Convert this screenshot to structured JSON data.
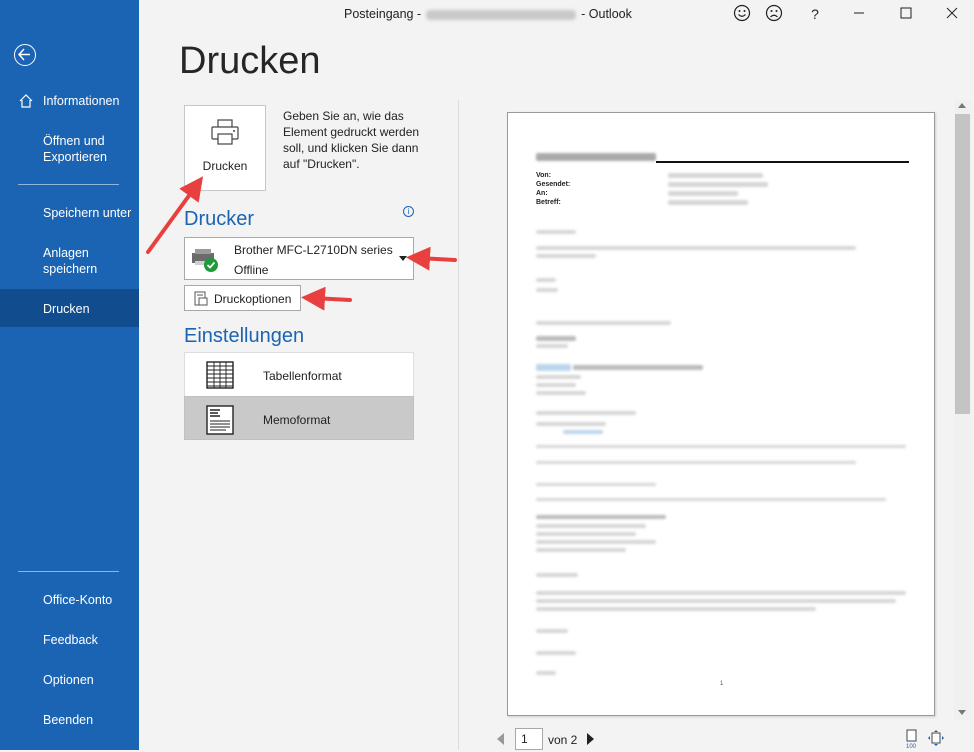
{
  "window": {
    "title_prefix": "Posteingang -",
    "title_suffix": "- Outlook",
    "happy_icon": "smile-icon",
    "sad_icon": "frown-icon",
    "help_label": "?"
  },
  "sidebar": {
    "items": [
      {
        "label": "Informationen"
      },
      {
        "label": "Öffnen und Exportieren"
      },
      {
        "label": "Speichern unter"
      },
      {
        "label": "Anlagen speichern"
      },
      {
        "label": "Drucken"
      },
      {
        "label": "Office-Konto"
      },
      {
        "label": "Feedback"
      },
      {
        "label": "Optionen"
      },
      {
        "label": "Beenden"
      }
    ]
  },
  "main": {
    "title": "Drucken",
    "print_button_label": "Drucken",
    "help_text": "Geben Sie an, wie das Element gedruckt werden soll, und klicken Sie dann auf \"Drucken\".",
    "printer_heading": "Drucker",
    "printer_name": "Brother MFC-L2710DN series",
    "printer_status": "Offline",
    "print_options_label": "Druckoptionen",
    "settings_heading": "Einstellungen",
    "formats": [
      {
        "label": "Tabellenformat",
        "selected": false
      },
      {
        "label": "Memoformat",
        "selected": true
      }
    ]
  },
  "preview": {
    "header_labels": [
      "Von:",
      "Gesendet:",
      "An:",
      "Betreff:"
    ],
    "page_number_mark": "1",
    "current_page": "1",
    "page_total_label": "von 2"
  },
  "colors": {
    "sidebar_bg": "#1a64b3",
    "sidebar_active": "#114c8e",
    "accent": "#1a64b3",
    "annotation_arrow": "#e8403f"
  }
}
